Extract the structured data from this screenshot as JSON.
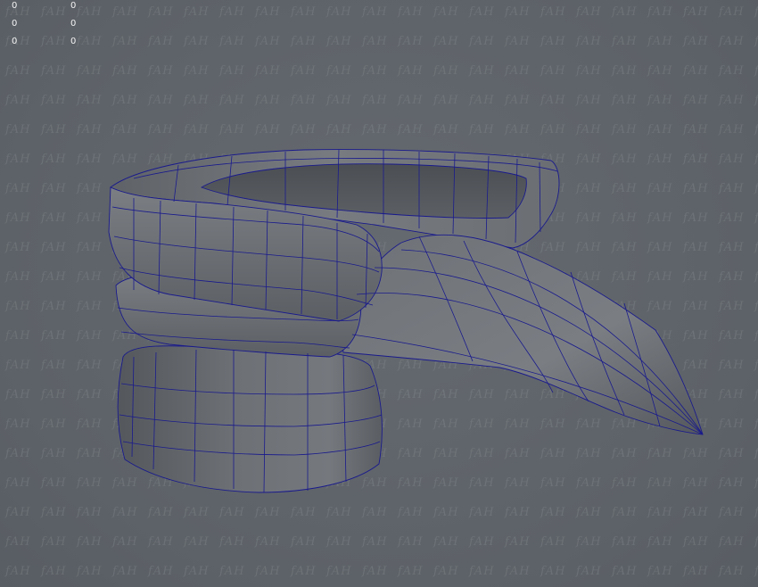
{
  "viewport": {
    "background_color": "#5f646a",
    "mesh_fill_color": "#6a6e73",
    "wireframe_color": "#1a1a8c"
  },
  "watermark": {
    "text": "fAH"
  },
  "hud": {
    "rows": [
      {
        "left": "0",
        "right": "0"
      },
      {
        "left": "0",
        "right": "0"
      },
      {
        "left": "0",
        "right": "0"
      }
    ]
  }
}
